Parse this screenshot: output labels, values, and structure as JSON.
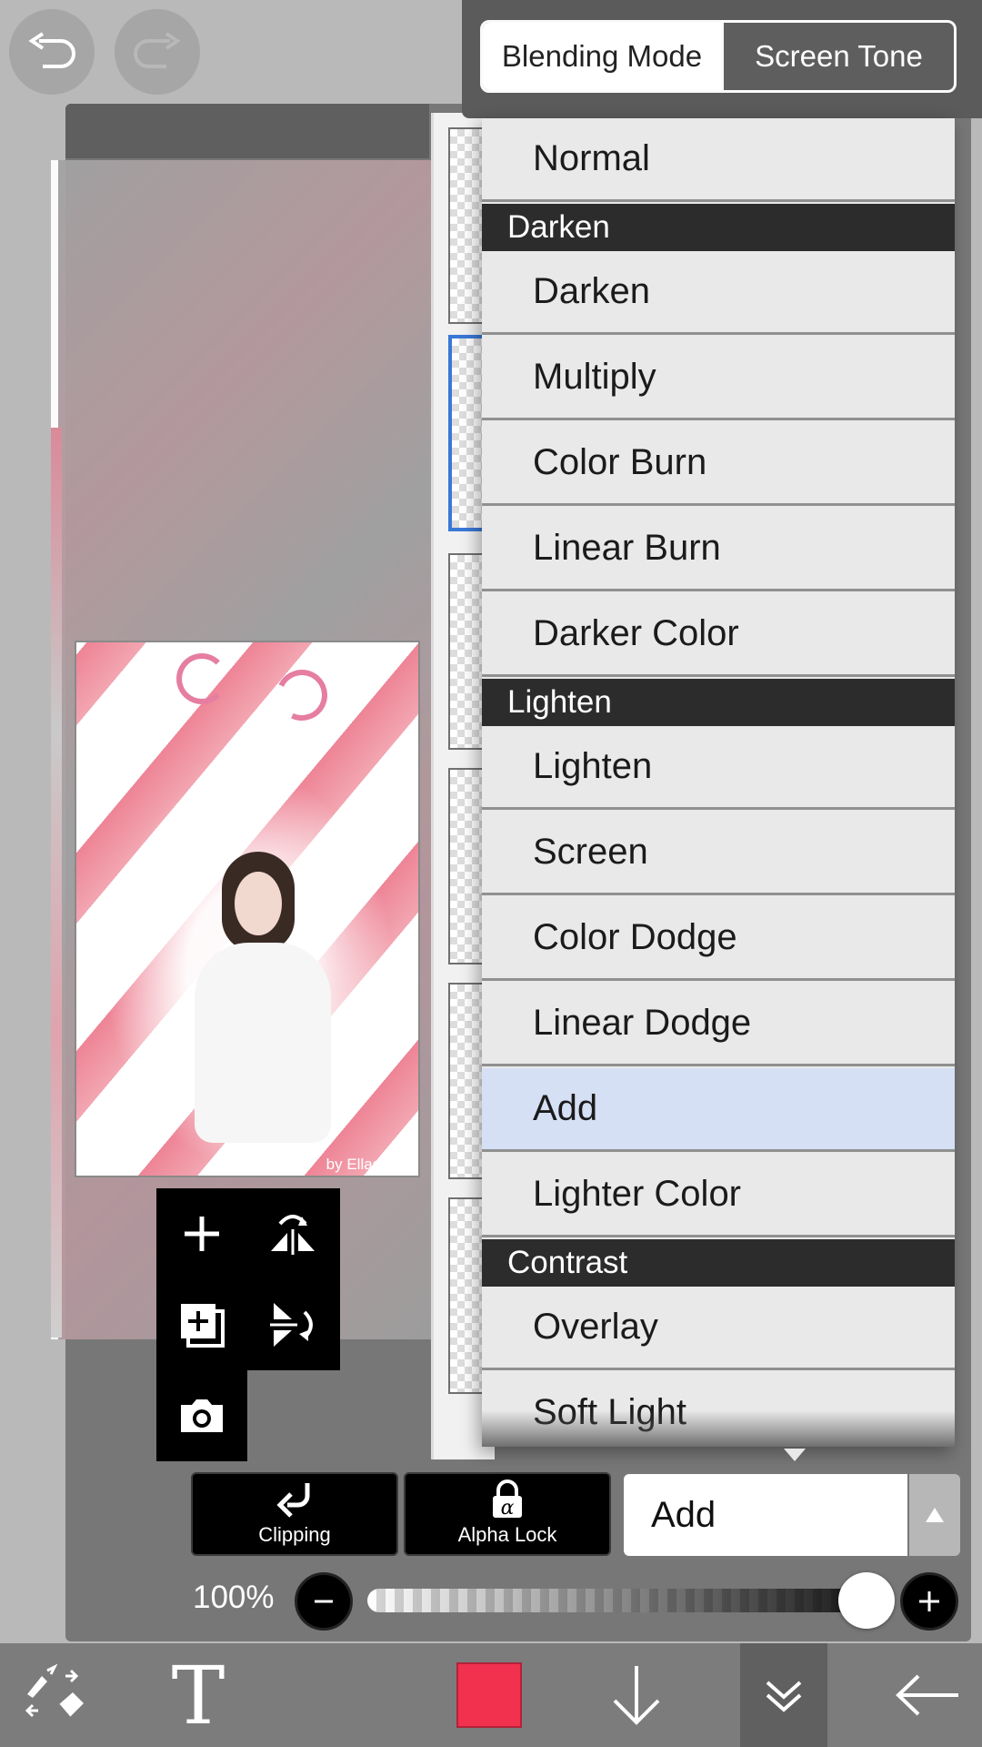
{
  "tabs": {
    "blending_mode": "Blending Mode",
    "screen_tone": "Screen Tone"
  },
  "blend_menu": {
    "items": [
      {
        "type": "option",
        "label": "Normal"
      },
      {
        "type": "header",
        "label": "Darken"
      },
      {
        "type": "option",
        "label": "Darken"
      },
      {
        "type": "option",
        "label": "Multiply"
      },
      {
        "type": "option",
        "label": "Color Burn"
      },
      {
        "type": "option",
        "label": "Linear Burn"
      },
      {
        "type": "option",
        "label": "Darker Color"
      },
      {
        "type": "header",
        "label": "Lighten"
      },
      {
        "type": "option",
        "label": "Lighten"
      },
      {
        "type": "option",
        "label": "Screen"
      },
      {
        "type": "option",
        "label": "Color Dodge"
      },
      {
        "type": "option",
        "label": "Linear Dodge"
      },
      {
        "type": "option",
        "label": "Add",
        "selected": true
      },
      {
        "type": "option",
        "label": "Lighter Color"
      },
      {
        "type": "header",
        "label": "Contrast"
      },
      {
        "type": "option",
        "label": "Overlay"
      },
      {
        "type": "option",
        "label": "Soft Light"
      }
    ]
  },
  "controls": {
    "clipping_label": "Clipping",
    "alpha_lock_label": "Alpha Lock",
    "current_blend": "Add",
    "opacity_label": "100%",
    "opacity_value": 1.0
  },
  "thumbnail": {
    "credit_text": "by Ellagance"
  },
  "toolbar": {
    "primary_color": "#f2314f",
    "text_tool_glyph": "T"
  },
  "colors": {
    "selected_option": "#d5e0f4",
    "header_bg": "#2c2c2c",
    "accent": "#f2314f"
  }
}
